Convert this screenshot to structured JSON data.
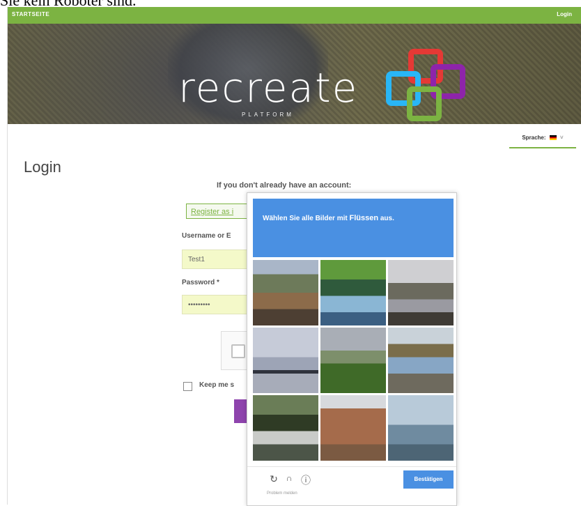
{
  "caption": "Sie kein Roboter sind.",
  "topbar": {
    "home_label": "STARTSEITE",
    "login_label": "Login"
  },
  "banner": {
    "brand": "recreate",
    "tagline": "PLATFORM"
  },
  "language": {
    "label": "Sprache:"
  },
  "page": {
    "title": "Login",
    "account_prompt": "If you don't already have an account:"
  },
  "form": {
    "register_label": "Register as i",
    "username_label": "Username or E",
    "username_value": "Test1",
    "password_label": "Password *",
    "password_value": "•••••••••",
    "keep_label": "Keep me s"
  },
  "recaptcha": {
    "instruction_prefix": "Wählen Sie alle Bilder mit ",
    "instruction_keyword": "Flüssen",
    "instruction_suffix": " aus.",
    "verify_label": "Bestätigen",
    "report_label": "Problem melden",
    "reload_icon": "↻",
    "audio_icon": "🎧",
    "info_icon": "ⓘ"
  },
  "colors": {
    "accent": "#7cb342",
    "recaptcha_blue": "#4a90e2",
    "button_purple": "#8e44ad"
  }
}
